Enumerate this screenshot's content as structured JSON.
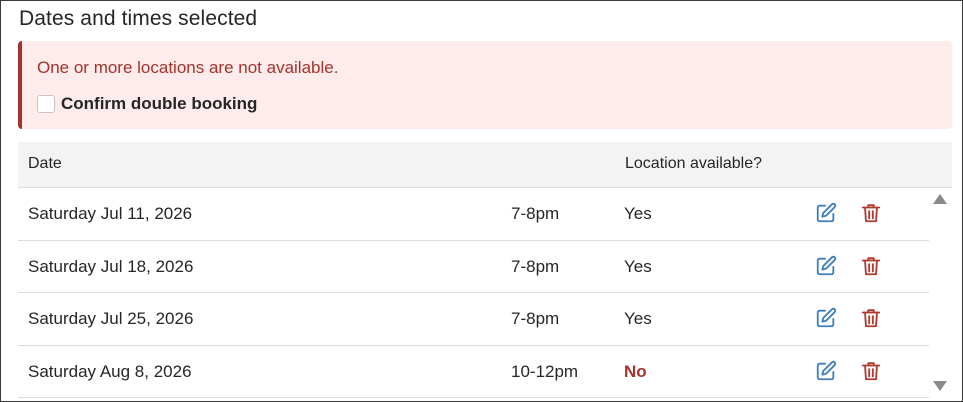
{
  "panel": {
    "title": "Dates and times selected"
  },
  "alert": {
    "message": "One or more locations are not available.",
    "confirm_label": "Confirm double booking",
    "confirm_checked": false
  },
  "table": {
    "headers": {
      "date": "Date",
      "location": "Location available?"
    },
    "rows": [
      {
        "date": "Saturday Jul 11, 2026",
        "time": "7-8pm",
        "available": "Yes"
      },
      {
        "date": "Saturday Jul 18, 2026",
        "time": "7-8pm",
        "available": "Yes"
      },
      {
        "date": "Saturday Jul 25, 2026",
        "time": "7-8pm",
        "available": "Yes"
      },
      {
        "date": "Saturday Aug 8, 2026",
        "time": "10-12pm",
        "available": "No"
      }
    ]
  },
  "icons": {
    "edit": "edit-icon",
    "delete": "trash-icon",
    "scroll_up": "arrow-up-icon",
    "scroll_down": "arrow-down-icon"
  },
  "colors": {
    "error": "#a4332b",
    "alert_bg": "#fdeceb",
    "edit_icon": "#3f7fbf",
    "delete_icon": "#b03a30",
    "header_bg": "#f3f3f3"
  }
}
